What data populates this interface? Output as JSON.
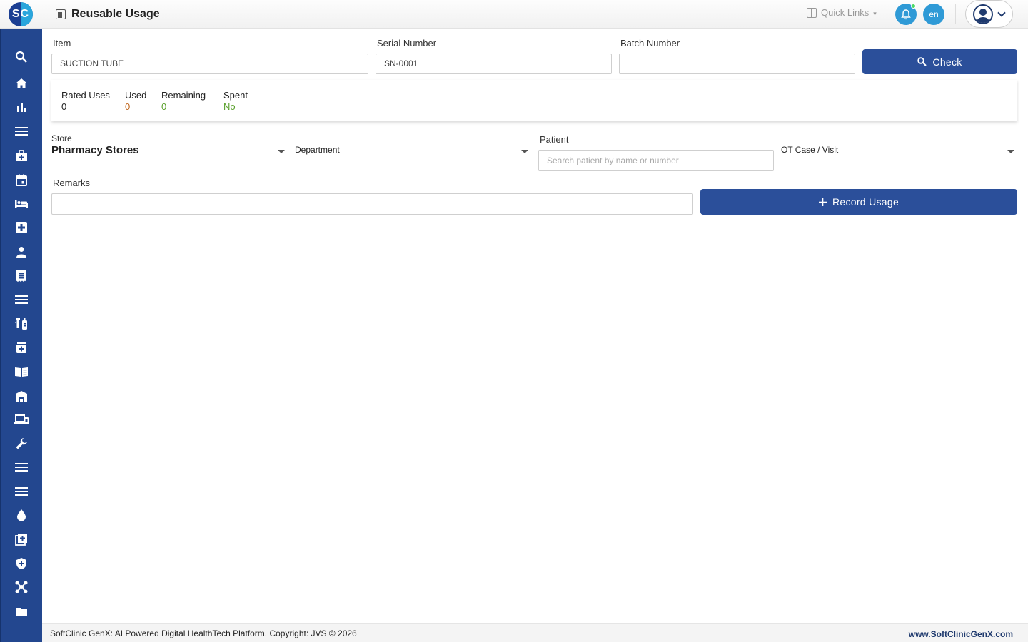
{
  "app": {
    "logo_text": "SC",
    "page_title": "Reusable Usage"
  },
  "header": {
    "quick_links_label": "Quick Links",
    "language_label": "en"
  },
  "sidebar": {
    "items": [
      {
        "icon": "search-icon"
      },
      {
        "icon": "home-icon"
      },
      {
        "icon": "bar-chart-icon"
      },
      {
        "icon": "menu-icon"
      },
      {
        "icon": "medical-bag-icon"
      },
      {
        "icon": "calendar-icon"
      },
      {
        "icon": "bed-icon"
      },
      {
        "icon": "medical-cross-icon"
      },
      {
        "icon": "person-icon"
      },
      {
        "icon": "receipt-icon"
      },
      {
        "icon": "list-icon"
      },
      {
        "icon": "lab-icon"
      },
      {
        "icon": "pharmacy-icon"
      },
      {
        "icon": "book-icon"
      },
      {
        "icon": "warehouse-icon"
      },
      {
        "icon": "devices-icon"
      },
      {
        "icon": "wrench-icon"
      },
      {
        "icon": "lines-icon"
      },
      {
        "icon": "lines-alt-icon"
      },
      {
        "icon": "drop-icon"
      },
      {
        "icon": "add-box-icon"
      },
      {
        "icon": "shield-icon"
      },
      {
        "icon": "network-icon"
      },
      {
        "icon": "folder-icon"
      }
    ]
  },
  "lookup": {
    "item_label": "Item",
    "item_value": "SUCTION TUBE",
    "serial_label": "Serial Number",
    "serial_value": "SN-0001",
    "batch_label": "Batch Number",
    "batch_value": "",
    "check_label": "Check"
  },
  "stats": {
    "rated_label": "Rated Uses",
    "rated_value": "0",
    "used_label": "Used",
    "used_value": "0",
    "remaining_label": "Remaining",
    "remaining_value": "0",
    "spent_label": "Spent",
    "spent_value": "No"
  },
  "usage": {
    "store_label": "Store",
    "store_value": "Pharmacy Stores",
    "department_value": "Department",
    "patient_label": "Patient",
    "patient_placeholder": "Search patient by name or number",
    "ot_value": "OT Case / Visit",
    "remarks_label": "Remarks",
    "remarks_value": "",
    "record_label": "Record Usage"
  },
  "footer": {
    "copyright": "SoftClinic GenX: AI Powered Digital HealthTech Platform. Copyright: JVS © 2026",
    "website": "www.SoftClinicGenX.com"
  },
  "colors": {
    "primary": "#2b4f9a",
    "sidebar": "#23478f",
    "accent": "#2f9ad6",
    "used_value": "#c0651b",
    "remaining_value": "#5aa02c",
    "spent_value": "#5aa02c"
  }
}
